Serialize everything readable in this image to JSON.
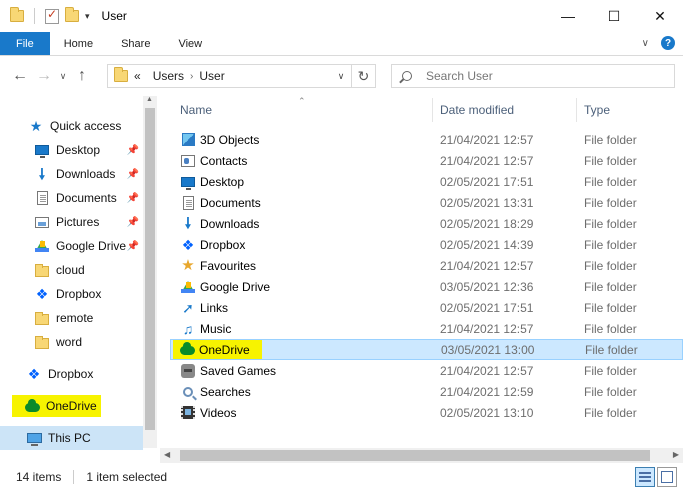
{
  "window": {
    "title": "User"
  },
  "ribbon": {
    "tabs": [
      "File",
      "Home",
      "Share",
      "View"
    ]
  },
  "address": {
    "overflow": "«",
    "crumbs": [
      "Users",
      "User"
    ],
    "search_placeholder": "Search User"
  },
  "nav": {
    "items": [
      {
        "label": "Quick access",
        "icon": "star-icon"
      },
      {
        "label": "Desktop",
        "icon": "desktop-icon",
        "pinned": true
      },
      {
        "label": "Downloads",
        "icon": "downloads-icon",
        "pinned": true
      },
      {
        "label": "Documents",
        "icon": "documents-icon",
        "pinned": true
      },
      {
        "label": "Pictures",
        "icon": "pictures-icon",
        "pinned": true
      },
      {
        "label": "Google Drive",
        "icon": "google-drive-icon",
        "pinned": true
      },
      {
        "label": "cloud",
        "icon": "folder-icon"
      },
      {
        "label": "Dropbox",
        "icon": "dropbox-icon"
      },
      {
        "label": "remote",
        "icon": "folder-icon"
      },
      {
        "label": "word",
        "icon": "folder-icon"
      },
      {
        "label": "Dropbox",
        "icon": "dropbox-icon"
      },
      {
        "label": "OneDrive",
        "icon": "onedrive-icon",
        "highlighted": true
      },
      {
        "label": "This PC",
        "icon": "this-pc-icon",
        "selected": true
      }
    ]
  },
  "columns": {
    "name": "Name",
    "date": "Date modified",
    "type": "Type"
  },
  "files": [
    {
      "name": "3D Objects",
      "date": "21/04/2021 12:57",
      "type": "File folder",
      "icon": "3d-objects-icon"
    },
    {
      "name": "Contacts",
      "date": "21/04/2021 12:57",
      "type": "File folder",
      "icon": "contacts-icon"
    },
    {
      "name": "Desktop",
      "date": "02/05/2021 17:51",
      "type": "File folder",
      "icon": "desktop-icon"
    },
    {
      "name": "Documents",
      "date": "02/05/2021 13:31",
      "type": "File folder",
      "icon": "documents-icon"
    },
    {
      "name": "Downloads",
      "date": "02/05/2021 18:29",
      "type": "File folder",
      "icon": "downloads-icon"
    },
    {
      "name": "Dropbox",
      "date": "02/05/2021 14:39",
      "type": "File folder",
      "icon": "dropbox-icon"
    },
    {
      "name": "Favourites",
      "date": "21/04/2021 12:57",
      "type": "File folder",
      "icon": "favourites-icon"
    },
    {
      "name": "Google Drive",
      "date": "03/05/2021 12:36",
      "type": "File folder",
      "icon": "google-drive-icon"
    },
    {
      "name": "Links",
      "date": "02/05/2021 17:51",
      "type": "File folder",
      "icon": "links-icon"
    },
    {
      "name": "Music",
      "date": "21/04/2021 12:57",
      "type": "File folder",
      "icon": "music-icon"
    },
    {
      "name": "OneDrive",
      "date": "03/05/2021 13:00",
      "type": "File folder",
      "icon": "onedrive-icon",
      "selected": true
    },
    {
      "name": "Saved Games",
      "date": "21/04/2021 12:57",
      "type": "File folder",
      "icon": "saved-games-icon"
    },
    {
      "name": "Searches",
      "date": "21/04/2021 12:59",
      "type": "File folder",
      "icon": "searches-icon"
    },
    {
      "name": "Videos",
      "date": "02/05/2021 13:10",
      "type": "File folder",
      "icon": "videos-icon"
    }
  ],
  "status": {
    "count": "14 items",
    "selection": "1 item selected"
  },
  "colors": {
    "accent": "#1979ca",
    "highlight": "#f7f300",
    "selection": "#cce8ff"
  }
}
